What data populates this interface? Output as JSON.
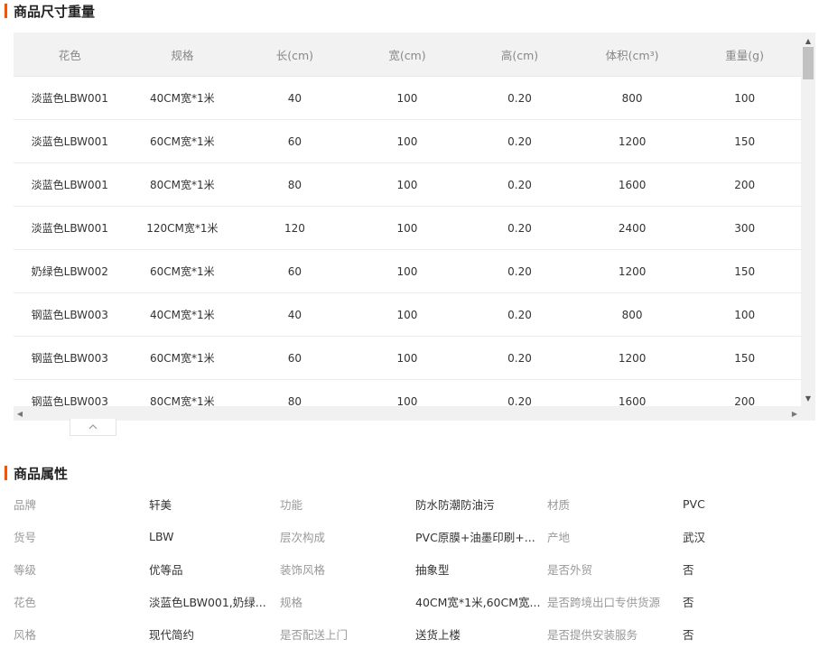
{
  "size_section": {
    "title": "商品尺寸重量",
    "columns": [
      "花色",
      "规格",
      "长(cm)",
      "宽(cm)",
      "高(cm)",
      "体积(cm³)",
      "重量(g)"
    ],
    "rows": [
      [
        "淡蓝色LBW001",
        "40CM宽*1米",
        "40",
        "100",
        "0.20",
        "800",
        "100"
      ],
      [
        "淡蓝色LBW001",
        "60CM宽*1米",
        "60",
        "100",
        "0.20",
        "1200",
        "150"
      ],
      [
        "淡蓝色LBW001",
        "80CM宽*1米",
        "80",
        "100",
        "0.20",
        "1600",
        "200"
      ],
      [
        "淡蓝色LBW001",
        "120CM宽*1米",
        "120",
        "100",
        "0.20",
        "2400",
        "300"
      ],
      [
        "奶绿色LBW002",
        "60CM宽*1米",
        "60",
        "100",
        "0.20",
        "1200",
        "150"
      ],
      [
        "钢蓝色LBW003",
        "40CM宽*1米",
        "40",
        "100",
        "0.20",
        "800",
        "100"
      ],
      [
        "钢蓝色LBW003",
        "60CM宽*1米",
        "60",
        "100",
        "0.20",
        "1200",
        "150"
      ],
      [
        "钢蓝色LBW003",
        "80CM宽*1米",
        "80",
        "100",
        "0.20",
        "1600",
        "200"
      ]
    ],
    "collapse_icon": "chevron-up-icon"
  },
  "attr_section": {
    "title": "商品属性",
    "rows": [
      [
        {
          "label": "品牌",
          "value": "轩美"
        },
        {
          "label": "功能",
          "value": "防水防潮防油污"
        },
        {
          "label": "材质",
          "value": "PVC"
        }
      ],
      [
        {
          "label": "货号",
          "value": "LBW"
        },
        {
          "label": "层次构成",
          "value": "PVC原膜+油墨印刷+..."
        },
        {
          "label": "产地",
          "value": "武汉"
        }
      ],
      [
        {
          "label": "等级",
          "value": "优等品"
        },
        {
          "label": "装饰风格",
          "value": "抽象型"
        },
        {
          "label": "是否外贸",
          "value": "否"
        }
      ],
      [
        {
          "label": "花色",
          "value": "淡蓝色LBW001,奶绿..."
        },
        {
          "label": "规格",
          "value": "40CM宽*1米,60CM宽..."
        },
        {
          "label": "是否跨境出口专供货源",
          "value": "否"
        }
      ],
      [
        {
          "label": "风格",
          "value": "现代简约"
        },
        {
          "label": "是否配送上门",
          "value": "送货上楼"
        },
        {
          "label": "是否提供安装服务",
          "value": "否"
        }
      ]
    ]
  },
  "colors": {
    "accent": "#ff5000",
    "header_bg": "#f2f2f2",
    "label": "#999999",
    "value": "#333333"
  }
}
